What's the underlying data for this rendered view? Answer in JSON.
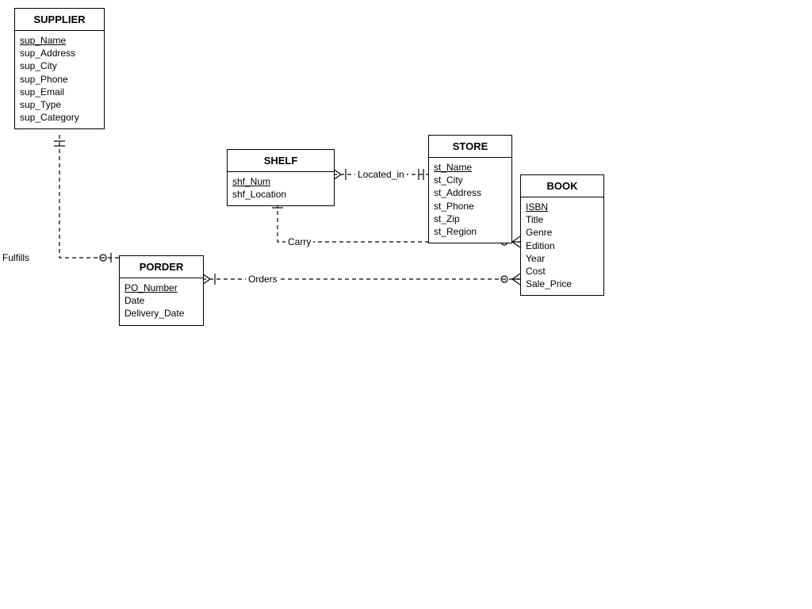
{
  "entities": {
    "supplier": {
      "title": "SUPPLIER",
      "attrs": [
        "sup_Name",
        "sup_Address",
        "sup_City",
        "sup_Phone",
        "sup_Email",
        "sup_Type",
        "sup_Category"
      ],
      "pk": [
        "sup_Name"
      ]
    },
    "shelf": {
      "title": "SHELF",
      "attrs": [
        "shf_Num",
        "shf_Location"
      ],
      "pk": [
        "shf_Num"
      ]
    },
    "store": {
      "title": "STORE",
      "attrs": [
        "st_Name",
        "st_City",
        "st_Address",
        "st_Phone",
        "st_Zip",
        "st_Region"
      ],
      "pk": [
        "st_Name"
      ]
    },
    "book": {
      "title": "BOOK",
      "attrs": [
        "ISBN",
        "Title",
        "Genre",
        "Edition",
        "Year",
        "Cost",
        "Sale_Price"
      ],
      "pk": [
        "ISBN"
      ]
    },
    "porder": {
      "title": "PORDER",
      "attrs": [
        "PO_Number",
        "Date",
        "Delivery_Date"
      ],
      "pk": [
        "PO_Number"
      ]
    }
  },
  "relationships": {
    "fulfills": {
      "label": "Fulfills",
      "between": [
        "supplier",
        "porder"
      ]
    },
    "located_in": {
      "label": "Located_in",
      "between": [
        "shelf",
        "store"
      ]
    },
    "carry": {
      "label": "Carry",
      "between": [
        "shelf",
        "book"
      ]
    },
    "orders": {
      "label": "Orders",
      "between": [
        "porder",
        "book"
      ]
    }
  }
}
